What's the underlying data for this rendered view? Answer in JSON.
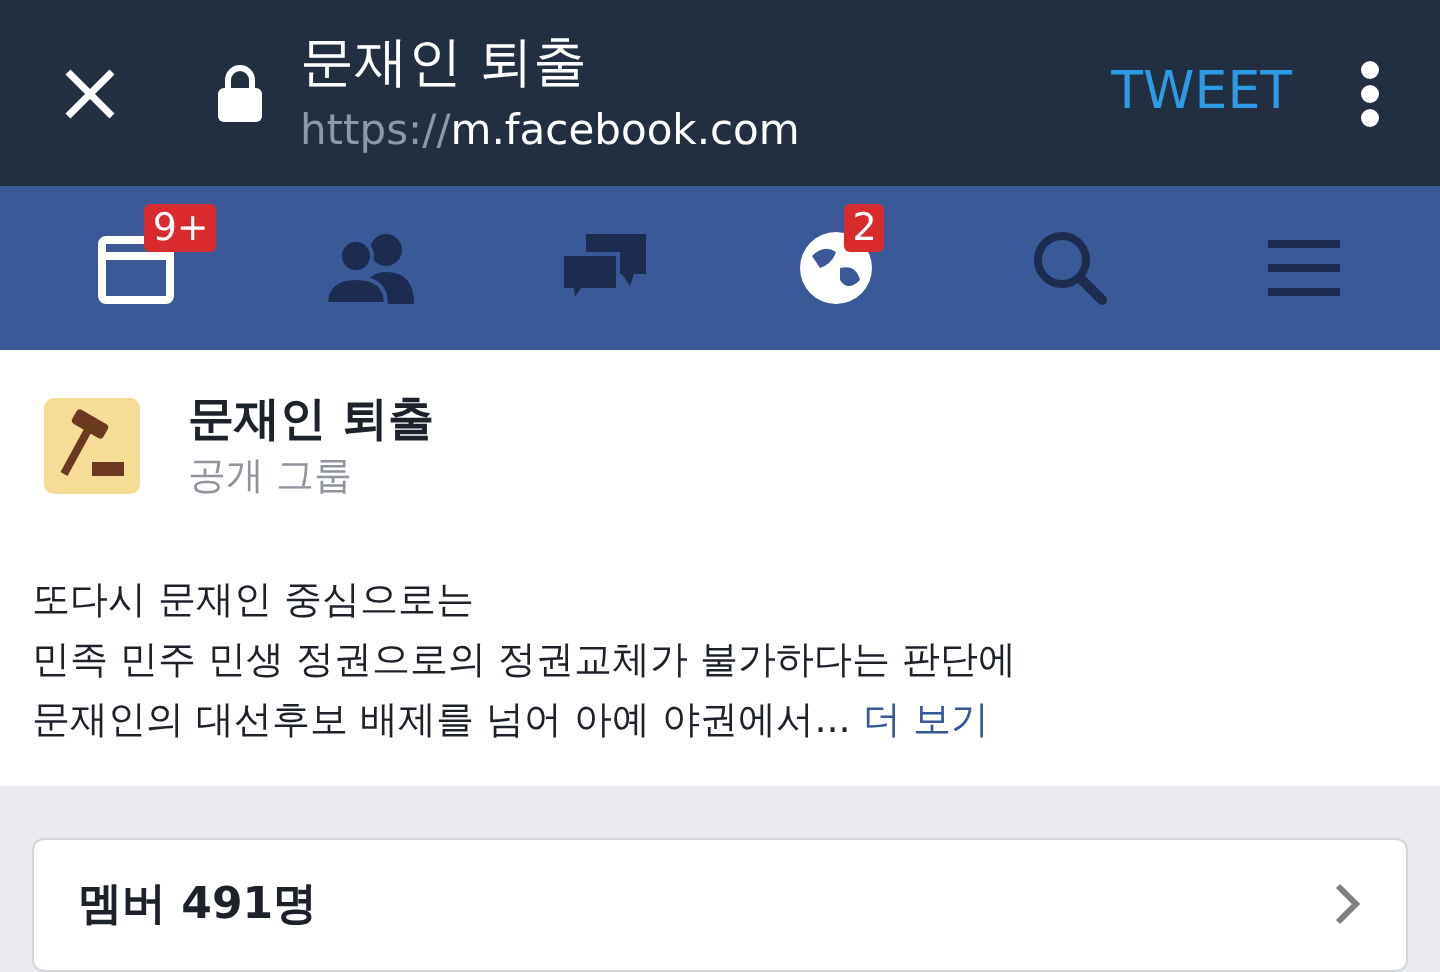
{
  "browser_bar": {
    "title": "문재인 퇴출",
    "url_scheme": "https://",
    "url_host": "m.facebook.com",
    "action": "TWEET"
  },
  "nav_tabs": [
    {
      "kind": "jewel",
      "active": true,
      "badge": "9+"
    },
    {
      "kind": "friends",
      "active": false
    },
    {
      "kind": "messages",
      "active": false
    },
    {
      "kind": "globe",
      "active": true,
      "badge": "2"
    },
    {
      "kind": "search",
      "active": false
    },
    {
      "kind": "menu",
      "active": false
    }
  ],
  "group": {
    "name": "문재인 퇴출",
    "privacy": "공개 그룹"
  },
  "description": {
    "lines": [
      "또다시 문재인 중심으로는",
      "민족 민주 민생 정권으로의 정권교체가 불가하다는 판단에",
      "문재인의 대선후보 배제를 넘어 아예 야권에서..."
    ],
    "more_link": "더 보기"
  },
  "members": {
    "label": "멤버 491명"
  }
}
